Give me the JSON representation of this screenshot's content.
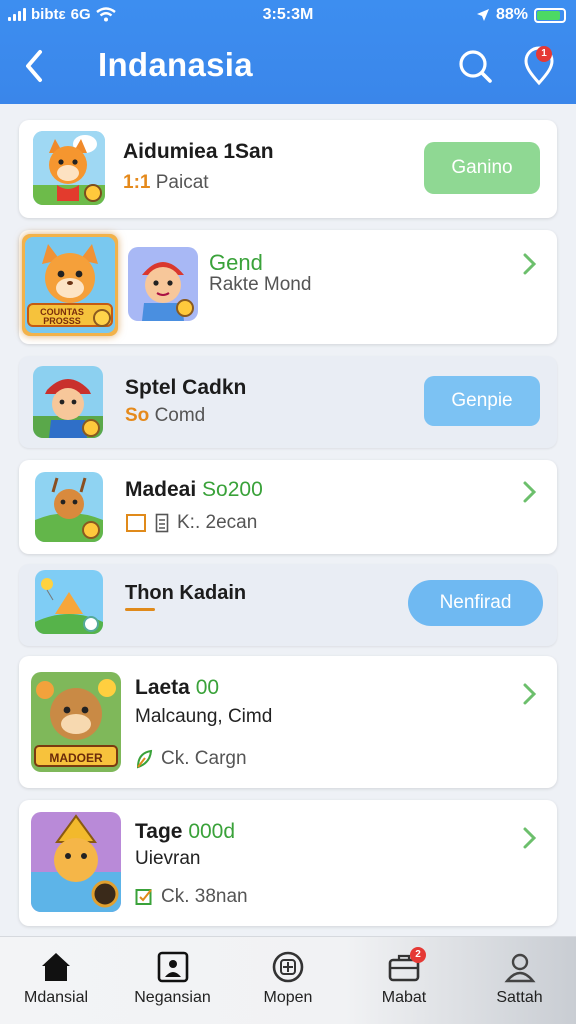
{
  "status_bar": {
    "carrier": "bibtε",
    "network": "6G",
    "time": "3:5:3M",
    "battery": "88%"
  },
  "header": {
    "title": "Indanasia"
  },
  "colors": {
    "header_blue": "#3d8ef0",
    "accent_green": "#3aa23a",
    "button_green": "#8fd893",
    "button_blue": "#7cc2f3",
    "badge_red": "#e53935"
  },
  "icons": [
    "back-arrow-icon",
    "search-icon",
    "location-pin-icon",
    "chevron-right-icon",
    "home-icon",
    "portrait-icon",
    "app-icon",
    "briefcase-icon",
    "user-icon"
  ],
  "notifications": {
    "pin_badge": "1"
  },
  "items": [
    {
      "name": "Aidumiea 1San",
      "sub_accent": "1:1",
      "sub": "Paicat",
      "button": "Ganino"
    },
    {
      "name": "Gend",
      "sub": "Rakte Mond",
      "thumb_caption": "COUNTAS PROSSS"
    },
    {
      "name": "Sptel Cadkn",
      "sub_accent": "So",
      "sub": "Comd",
      "button": "Genpie"
    },
    {
      "name_plain": "Madeai",
      "name_accent": "So200",
      "sub": "K:. 2ecan"
    },
    {
      "name": "Thon Kadain",
      "button": "Nenfirad"
    },
    {
      "name_plain": "Laeta",
      "name_accent": "00",
      "line2": "Malcaung, Cimd",
      "sub": "Ck. Cargn",
      "thumb_caption": "MADOER"
    },
    {
      "name_plain": "Tage",
      "name_accent": "000d",
      "line2": "Uievran",
      "sub": "Ck. 38nan"
    }
  ],
  "nav": [
    {
      "label": "Mdansial"
    },
    {
      "label": "Negansian"
    },
    {
      "label": "Mopen"
    },
    {
      "label": "Mabat",
      "badge": "2"
    },
    {
      "label": "Sattah"
    }
  ]
}
